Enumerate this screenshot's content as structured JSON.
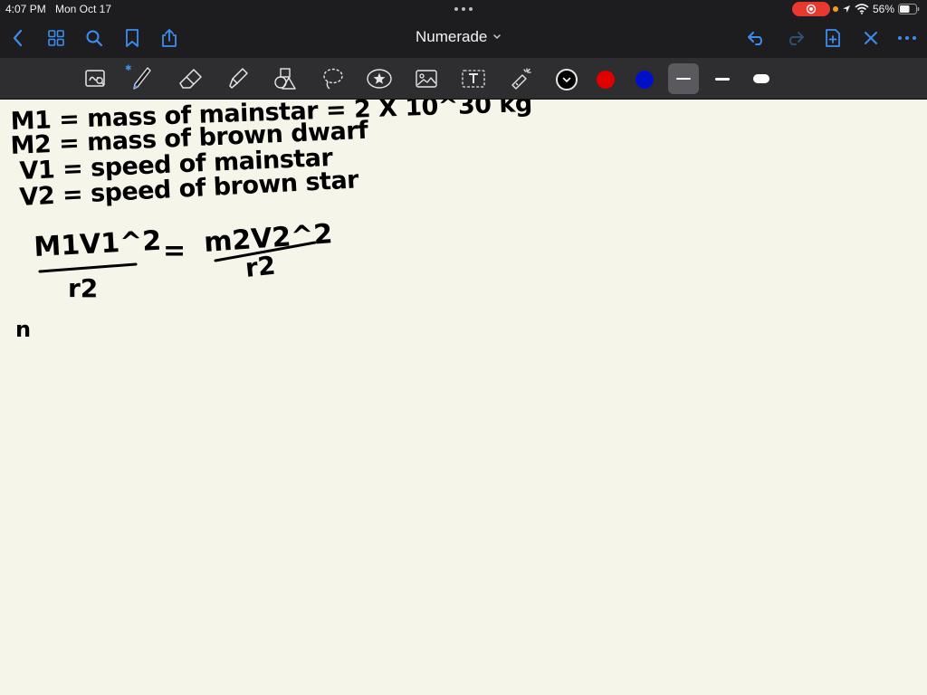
{
  "status_bar": {
    "time": "4:07 PM",
    "date": "Mon Oct 17",
    "battery": "56%",
    "recording": true
  },
  "nav": {
    "title": "Numerade",
    "buttons": [
      "back",
      "grid-view",
      "search",
      "bookmark",
      "share",
      "undo",
      "redo",
      "add-page",
      "close",
      "more"
    ]
  },
  "toolbar": {
    "tools": [
      "lasso-zoom",
      "pen",
      "eraser",
      "highlighter",
      "shapes",
      "lasso",
      "elements",
      "image",
      "text",
      "laser-pointer"
    ],
    "active_tool": "pen",
    "colors": [
      "#000000",
      "#e00000",
      "#0010c8"
    ],
    "selected_color": "#000000",
    "thickness_options": [
      "thin",
      "medium",
      "thick"
    ],
    "selected_thickness": "thin"
  },
  "note": {
    "lines": [
      "M1 = mass of mainstar = 2 X 10^30 kg",
      "M2 = mass of brown dwarf",
      "V1 = speed of mainstar",
      "V2 = speed of brown star"
    ],
    "equation": {
      "left_numerator": "M1V1^2",
      "left_denominator": "r2",
      "equals": "=",
      "right_numerator": "m2V2^2",
      "right_denominator": "r2"
    },
    "trailing_mark": "n"
  }
}
